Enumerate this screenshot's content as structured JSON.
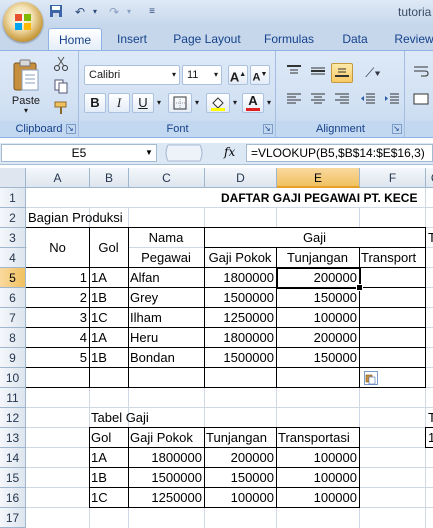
{
  "window": {
    "title_fragment": "tutoria"
  },
  "quick_access": {
    "save": "save-icon",
    "undo": "undo-icon",
    "redo": "redo-icon"
  },
  "ribbon_tabs": [
    "Home",
    "Insert",
    "Page Layout",
    "Formulas",
    "Data",
    "Review"
  ],
  "ribbon": {
    "clipboard": {
      "paste_label": "Paste",
      "group_label": "Clipboard"
    },
    "font": {
      "name": "Calibri",
      "size": "11",
      "group_label": "Font",
      "bold": "B",
      "italic": "I",
      "underline": "U",
      "grow": "A",
      "shrink": "A",
      "font_color": "A"
    },
    "alignment": {
      "group_label": "Alignment"
    }
  },
  "formula_bar": {
    "name_box": "E5",
    "fx": "fx",
    "formula": "=VLOOKUP(B5,$B$14:$E$16,3)"
  },
  "columns": [
    "A",
    "B",
    "C",
    "D",
    "E",
    "F",
    "G"
  ],
  "rows": [
    "1",
    "2",
    "3",
    "4",
    "5",
    "6",
    "7",
    "8",
    "9",
    "10",
    "11",
    "12",
    "13",
    "14",
    "15",
    "16",
    "17"
  ],
  "sheet": {
    "title": "DAFTAR GAJI PEGAWAI PT. KECE",
    "section": "Bagian Produksi",
    "headers": {
      "no": "No",
      "gol": "Gol",
      "nama_1": "Nama",
      "nama_2": "Pegawai",
      "gaji": "Gaji",
      "gaji_pokok": "Gaji Pokok",
      "tunjangan": "Tunjangan",
      "transport": "Transport",
      "t_cut": "T"
    },
    "employees": [
      {
        "no": "1",
        "gol": "1A",
        "nama": "Alfan",
        "gaji_pokok": "1800000",
        "tunjangan": "200000"
      },
      {
        "no": "2",
        "gol": "1B",
        "nama": "Grey",
        "gaji_pokok": "1500000",
        "tunjangan": "150000"
      },
      {
        "no": "3",
        "gol": "1C",
        "nama": "Ilham",
        "gaji_pokok": "1250000",
        "tunjangan": "100000"
      },
      {
        "no": "4",
        "gol": "1A",
        "nama": "Heru",
        "gaji_pokok": "1800000",
        "tunjangan": "200000"
      },
      {
        "no": "5",
        "gol": "1B",
        "nama": "Bondan",
        "gaji_pokok": "1500000",
        "tunjangan": "150000"
      }
    ],
    "salary_table": {
      "label": "Tabel Gaji",
      "headers": [
        "Gol",
        "Gaji Pokok",
        "Tunjangan",
        "Transportasi"
      ],
      "rows": [
        [
          "1A",
          "1800000",
          "200000",
          "100000"
        ],
        [
          "1B",
          "1500000",
          "150000",
          "100000"
        ],
        [
          "1C",
          "1250000",
          "100000",
          "100000"
        ]
      ],
      "g_cut_12": "T",
      "g_cut_13": "1"
    }
  },
  "colors": {
    "accent": "#15428b",
    "selection": "#f1c15f",
    "grid": "#d0d7e5"
  }
}
